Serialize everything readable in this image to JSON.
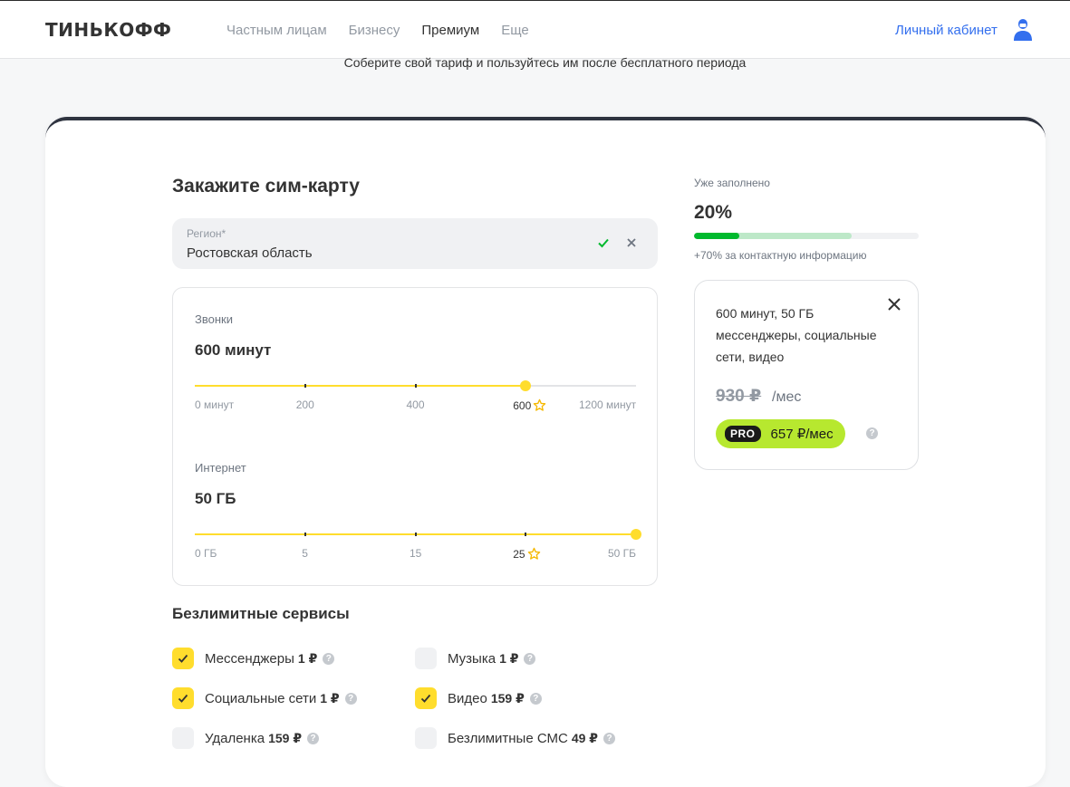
{
  "header": {
    "logo": "ТИНЬКОФФ",
    "nav": [
      "Частным лицам",
      "Бизнесу",
      "Премиум",
      "Еще"
    ],
    "active_nav": "Премиум",
    "cabinet": "Личный кабинет"
  },
  "subtitle": "Соберите свой тариф и пользуйтесь им после бесплатного периода",
  "order": {
    "title": "Закажите сим-карту",
    "region_label": "Регион*",
    "region_value": "Ростовская область"
  },
  "calls": {
    "label": "Звонки",
    "value": "600 минут",
    "ticks": [
      "0 минут",
      "200",
      "400",
      "600",
      "1200 минут"
    ],
    "selected_index": 3,
    "recommended_index": 3
  },
  "internet": {
    "label": "Интернет",
    "value": "50 ГБ",
    "ticks": [
      "0 ГБ",
      "5",
      "15",
      "25",
      "50 ГБ"
    ],
    "selected_index": 4,
    "recommended_index": 3
  },
  "unlimited": {
    "title": "Безлимитные сервисы",
    "services": [
      {
        "name": "Мессенджеры",
        "price": "1 ₽",
        "checked": true
      },
      {
        "name": "Музыка",
        "price": "1 ₽",
        "checked": false
      },
      {
        "name": "Социальные сети",
        "price": "1 ₽",
        "checked": true
      },
      {
        "name": "Видео",
        "price": "159 ₽",
        "checked": true
      },
      {
        "name": "Удаленка",
        "price": "159 ₽",
        "checked": false
      },
      {
        "name": "Безлимитные СМС",
        "price": "49 ₽",
        "checked": false
      }
    ]
  },
  "progress": {
    "label": "Уже заполнено",
    "percent_text": "20%",
    "percent": 20,
    "potential_percent": 70,
    "hint": "+70% за контактную информацию"
  },
  "summary": {
    "description": "600 минут, 50 ГБ мессенджеры, социальные сети, видео",
    "old_price": "930 ₽",
    "per_month": "/мес",
    "pro_label": "PRO",
    "pro_price": "657 ₽/мес"
  },
  "colors": {
    "accent_yellow": "#ffdd2d",
    "link_blue": "#336fee",
    "progress_green": "#00b92d",
    "pro_green": "#b7e82f"
  }
}
